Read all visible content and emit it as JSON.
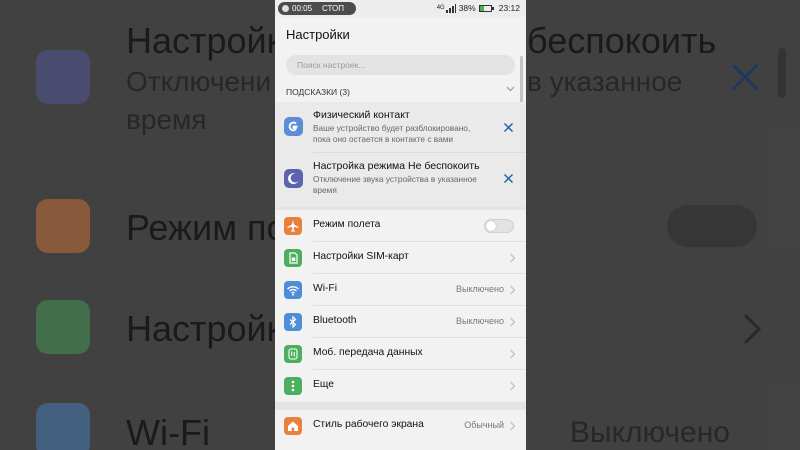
{
  "background": {
    "text_1": "Настройки",
    "text_1_tail": "беспокоить",
    "text_2": "Отключени",
    "text_2_tail": "в указанное",
    "text_3": "время",
    "text_4": "Режим по",
    "text_5": "Настройк",
    "text_6": "Wi-Fi",
    "text_6_value": "Выключено"
  },
  "status_bar": {
    "recording_time": "00:05",
    "recording_stop": "СТОП",
    "network": "4G",
    "battery_percent": "38%",
    "battery_level": 0.38,
    "clock": "23:12"
  },
  "app": {
    "title": "Настройки",
    "search_placeholder": "Поиск настроек..."
  },
  "tips": {
    "header": "ПОДСКАЗКИ (3)",
    "items": [
      {
        "title": "Физический контакт",
        "desc_line1": "Ваше устройство будет разблокировано,",
        "desc_line2": "пока оно остается в контакте с вами",
        "icon": "google-icon",
        "icon_color": "#5b8ed6"
      },
      {
        "title": "Настройка режима Не беспокоить",
        "desc_line1": "Отключение звука устройства в указанное",
        "desc_line2": "время",
        "icon": "moon-icon",
        "icon_color": "#5e63b0"
      }
    ]
  },
  "settings": [
    {
      "label": "Режим полета",
      "value": "",
      "icon": "airplane-icon",
      "color": "#e8813e",
      "toggle": true,
      "enabled": false
    },
    {
      "label": "Настройки SIM-карт",
      "value": "",
      "icon": "sim-card-icon",
      "color": "#4caf5e"
    },
    {
      "label": "Wi-Fi",
      "value": "Выключено",
      "icon": "wifi-icon",
      "color": "#4f8ed6"
    },
    {
      "label": "Bluetooth",
      "value": "Выключено",
      "icon": "bluetooth-icon",
      "color": "#4f8ed6"
    },
    {
      "label": "Моб. передача данных",
      "value": "",
      "icon": "mobile-data-icon",
      "color": "#4caf5e"
    },
    {
      "label": "Еще",
      "value": "",
      "icon": "more-icon",
      "color": "#4caf5e"
    }
  ],
  "display_settings": [
    {
      "label": "Стиль рабочего экрана",
      "value": "Обычный",
      "icon": "home-style-icon",
      "color": "#e8813e"
    }
  ]
}
